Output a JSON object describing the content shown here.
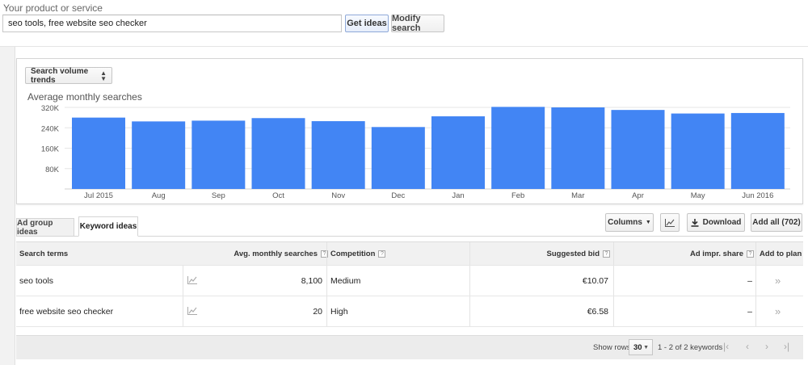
{
  "search": {
    "label": "Your product or service",
    "value": "seo tools, free website seo checker",
    "get_ideas": "Get ideas",
    "modify_search": "Modify search"
  },
  "chart_control": {
    "selector": "Search volume trends",
    "title": "Average monthly searches"
  },
  "chart_data": {
    "type": "bar",
    "title": "Average monthly searches",
    "categories": [
      "Jul 2015",
      "Aug",
      "Sep",
      "Oct",
      "Nov",
      "Dec",
      "Jan",
      "Feb",
      "Mar",
      "Apr",
      "May",
      "Jun 2016"
    ],
    "values": [
      280000,
      265000,
      268000,
      278000,
      266000,
      243000,
      285000,
      322000,
      320000,
      310000,
      296000,
      298000
    ],
    "y_ticks": [
      "80K",
      "160K",
      "240K",
      "320K"
    ],
    "ylim": [
      0,
      320000
    ],
    "bar_color": "#4285f4",
    "grid": true
  },
  "tabs": {
    "ad_group": "Ad group ideas",
    "keyword": "Keyword ideas"
  },
  "toolbar": {
    "columns": "Columns",
    "download": "Download",
    "add_all": "Add all (702)"
  },
  "table": {
    "headers": {
      "search_terms": "Search terms",
      "avg_monthly": "Avg. monthly searches",
      "competition": "Competition",
      "suggested_bid": "Suggested bid",
      "ad_impr_share": "Ad impr. share",
      "add_to_plan": "Add to plan"
    },
    "rows": [
      {
        "term": "seo tools",
        "searches": "8,100",
        "competition": "Medium",
        "bid": "€10.07",
        "share": "–"
      },
      {
        "term": "free website seo checker",
        "searches": "20",
        "competition": "High",
        "bid": "€6.58",
        "share": "–"
      }
    ]
  },
  "footer": {
    "show_rows_label": "Show rows:",
    "rows_value": "30",
    "range": "1 - 2 of 2 keywords"
  }
}
